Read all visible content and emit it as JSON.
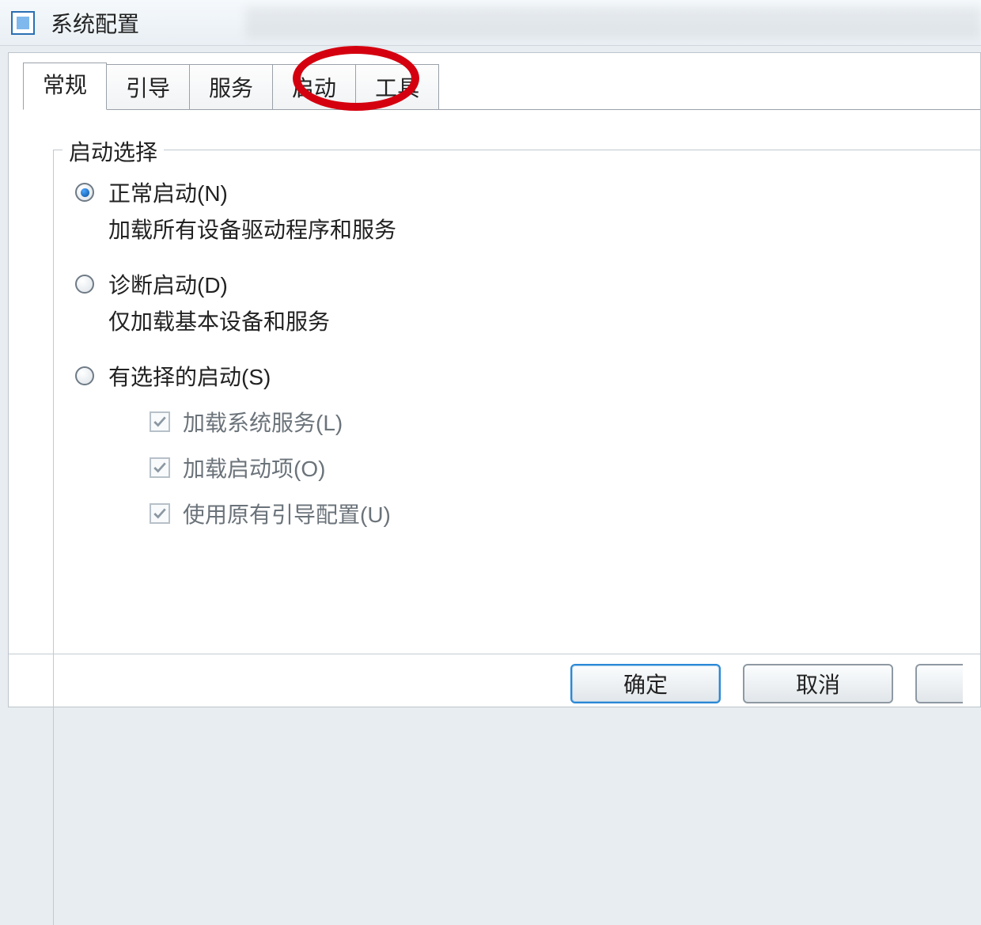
{
  "window": {
    "title": "系统配置",
    "icon": "msconfig-icon"
  },
  "tabs": {
    "items": [
      {
        "label": "常规",
        "active": true
      },
      {
        "label": "引导",
        "active": false
      },
      {
        "label": "服务",
        "active": false
      },
      {
        "label": "启动",
        "active": false,
        "highlighted": true
      },
      {
        "label": "工具",
        "active": false
      }
    ]
  },
  "group": {
    "legend": "启动选择",
    "options": [
      {
        "label": "正常启动(N)",
        "desc": "加载所有设备驱动程序和服务",
        "checked": true
      },
      {
        "label": "诊断启动(D)",
        "desc": "仅加载基本设备和服务",
        "checked": false
      },
      {
        "label": "有选择的启动(S)",
        "desc": "",
        "checked": false
      }
    ],
    "checks": [
      {
        "label": "加载系统服务(L)",
        "checked": true,
        "disabled": true
      },
      {
        "label": "加载启动项(O)",
        "checked": true,
        "disabled": true
      },
      {
        "label": "使用原有引导配置(U)",
        "checked": true,
        "disabled": true
      }
    ]
  },
  "buttons": {
    "ok": "确定",
    "cancel": "取消"
  }
}
